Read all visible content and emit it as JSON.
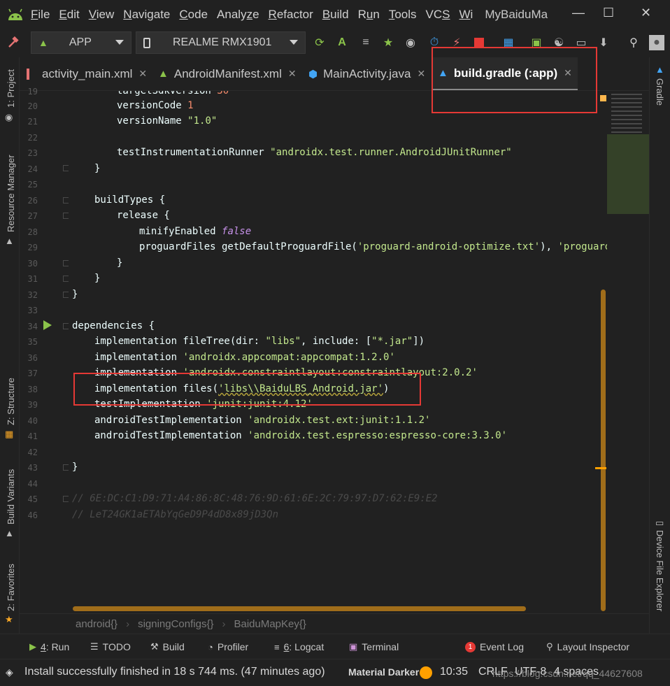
{
  "menu": {
    "items": [
      {
        "pre": "",
        "u": "F",
        "post": "ile"
      },
      {
        "pre": "",
        "u": "E",
        "post": "dit"
      },
      {
        "pre": "",
        "u": "V",
        "post": "iew"
      },
      {
        "pre": "",
        "u": "N",
        "post": "avigate"
      },
      {
        "pre": "",
        "u": "C",
        "post": "ode"
      },
      {
        "pre": "Analy",
        "u": "z",
        "post": "e"
      },
      {
        "pre": "",
        "u": "R",
        "post": "efactor"
      },
      {
        "pre": "",
        "u": "B",
        "post": "uild"
      },
      {
        "pre": "R",
        "u": "u",
        "post": "n"
      },
      {
        "pre": "",
        "u": "T",
        "post": "ools"
      },
      {
        "pre": "VC",
        "u": "S",
        "post": ""
      },
      {
        "pre": "",
        "u": "W",
        "post": "i"
      }
    ],
    "project_name": "MyBaiduMa"
  },
  "toolbar": {
    "run_config": "APP",
    "device": "REALME RMX1901"
  },
  "tabs": [
    {
      "label": "activity_main.xml",
      "icon": "xml-layout-icon",
      "color": "#e57373"
    },
    {
      "label": "AndroidManifest.xml",
      "icon": "android-icon",
      "color": "#a5d6a7"
    },
    {
      "label": "MainActivity.java",
      "icon": "java-class-icon",
      "color": "#42a5f5"
    },
    {
      "label": "build.gradle (:app)",
      "icon": "gradle-icon",
      "color": "#42a5f5"
    }
  ],
  "code": {
    "line_numbers": [
      "19",
      "20",
      "21",
      "22",
      "23",
      "24",
      "25",
      "26",
      "27",
      "28",
      "29",
      "30",
      "31",
      "32",
      "33",
      "34",
      "35",
      "36",
      "37",
      "38",
      "39",
      "40",
      "41",
      "42",
      "43",
      "44",
      "45",
      "46"
    ],
    "l19_a": "targetSdkVersion",
    "l19_b": "30",
    "l20_a": "versionCode",
    "l20_b": "1",
    "l21_a": "versionName",
    "l21_b": "\"1.0\"",
    "l23_a": "testInstrumentationRunner",
    "l23_b": "\"androidx.test.runner.AndroidJUnitRunner\"",
    "l24": "}",
    "l26": "buildTypes {",
    "l27": "release {",
    "l28_a": "minifyEnabled",
    "l28_b": "false",
    "l29_a": "proguardFiles getDefaultProguardFile(",
    "l29_b": "'proguard-android-optimize.txt'",
    "l29_c": "), ",
    "l29_d": "'proguard-rul",
    "l30": "}",
    "l31": "}",
    "l32": "}",
    "l34": "dependencies {",
    "l35_a": "implementation fileTree(dir: ",
    "l35_b": "\"libs\"",
    "l35_c": ", include: [",
    "l35_d": "\"*.jar\"",
    "l35_e": "])",
    "l36_a": "implementation ",
    "l36_b": "'androidx.appcompat:appcompat:1.2.0'",
    "l37_a": "implementation ",
    "l37_b": "'androidx.constraintlayout:constraintlayout:2.0.2'",
    "l38_a": "implementation ",
    "l38_b": "files(",
    "l38_c": "'libs\\\\BaiduLBS_Android.jar'",
    "l38_d": ")",
    "l39_a": "testImplementation ",
    "l39_b": "'junit:junit:4.12'",
    "l40_a": "androidTestImplementation ",
    "l40_b": "'androidx.test.ext:junit:1.1.2'",
    "l41_a": "androidTestImplementation ",
    "l41_b": "'androidx.test.espresso:espresso-core:3.3.0'",
    "l43": "}",
    "l45": "// 6E:DC:C1:D9:71:A4:86:8C:48:76:9D:61:6E:2C:79:97:D7:62:E9:E2",
    "l46": "// LeT24GK1aETAbYqGeD9P4dD8x89jD3Qn"
  },
  "breadcrumb": [
    "android{}",
    "signingConfigs{}",
    "BaiduMapKey{}"
  ],
  "left_strip": [
    "1: Project",
    "Resource Manager",
    "Z: Structure",
    "Build Variants",
    "2: Favorites"
  ],
  "right_strip": [
    "Gradle",
    "Device File Explorer"
  ],
  "tool_windows": {
    "run": {
      "u": "4",
      "rest": ": Run"
    },
    "todo": "TODO",
    "build": "Build",
    "profiler": "Profiler",
    "logcat": {
      "u": "6",
      "rest": ": Logcat"
    },
    "terminal": "Terminal",
    "event_log_count": "1",
    "event_log": "Event Log",
    "layout_inspector": "Layout Inspector"
  },
  "status": {
    "message": "Install successfully finished in 18 s 744 ms. (47 minutes ago)",
    "theme": "Material Darker",
    "position": "10:35",
    "line_sep": "CRLF",
    "encoding": "UTF-8",
    "indent": "4 spaces",
    "watermark": "https://blog.csdn.net/qq_44627608"
  },
  "colors": {
    "accent": "#ffa000",
    "annotation": "#e53935"
  }
}
